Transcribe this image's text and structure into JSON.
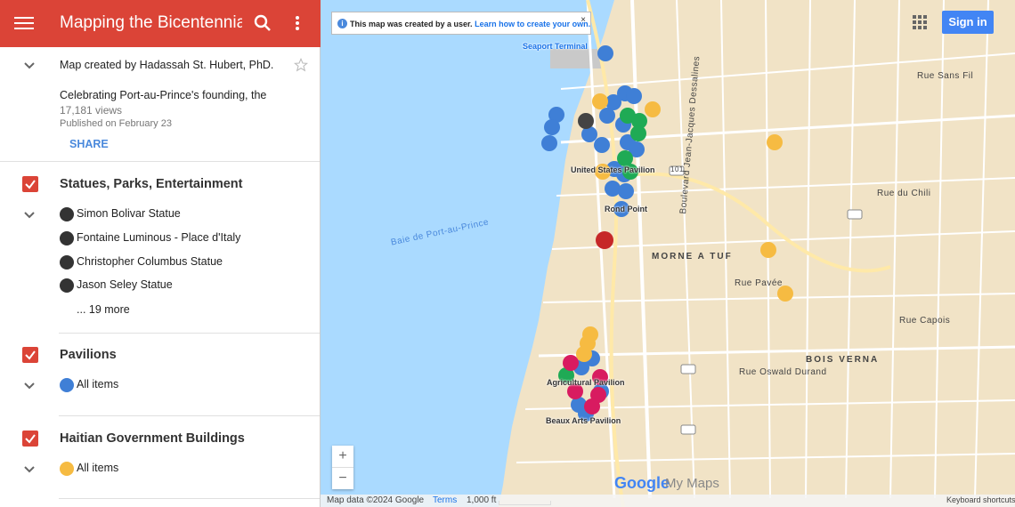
{
  "header": {
    "title": "Mapping the Bicentennial Ex"
  },
  "intro": {
    "creator": "Map created by Hadassah St. Hubert, PhD.",
    "description": "Celebrating Port-au-Prince's founding, the",
    "views": "17,181 views",
    "published": "Published on February 23",
    "share_label": "SHARE"
  },
  "layers": [
    {
      "title": "Statues, Parks, Entertainment",
      "items": [
        "Simon Bolivar Statue",
        "Fontaine Luminous - Place d'Italy",
        "Christopher Columbus Statue",
        "Jason Seley Statue"
      ],
      "more": "... 19 more"
    },
    {
      "title": "Pavilions",
      "items": [
        "All items"
      ]
    },
    {
      "title": "Haitian Government Buildings",
      "items": [
        "All items"
      ]
    }
  ],
  "map": {
    "info_bold": "This map was created by a user.",
    "info_link": "Learn how to create your own.",
    "info_close": "×",
    "signin_label": "Sign in",
    "zoom_in": "+",
    "zoom_out": "−",
    "google_logo": "Google",
    "mymaps": "My Maps",
    "attribution": "Map data ©2024 Google",
    "terms": "Terms",
    "scale": "1,000 ft",
    "shortcuts": "Keyboard shortcuts",
    "labels": {
      "seaport": "Seaport Terminal",
      "us_pavilion": "United States Pavilion",
      "rond_point": "Rond Point",
      "agri": "Agricultural Pavilion",
      "beaux": "Beaux Arts Pavilion",
      "baie": "Baie de Port-au-Prince",
      "boulevard": "Boulevard Jean-Jacques Dessalines",
      "morne": "MORNE A TUF",
      "bois": "BOIS VERNA",
      "rue_pavee": "Rue Pavée",
      "rue_capois": "Rue Capois",
      "rue_oswald": "Rue Oswald Durand",
      "rue_chili": "Rue du Chili",
      "rue_sans_fil": "Rue Sans Fil",
      "rte101": "101"
    },
    "colors": {
      "water": "#aadaff",
      "land": "#f1e3c6",
      "blue_pin": "#3f7fd6",
      "orange_pin": "#f6bb42",
      "green_pin": "#1faa55",
      "red_pin": "#c62828",
      "pink_pin": "#d81b60",
      "dark_pin": "#444444"
    }
  }
}
